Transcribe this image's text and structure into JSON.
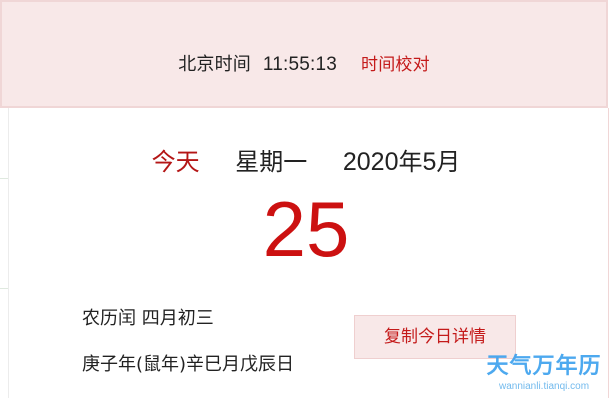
{
  "beijing_time": {
    "label": "北京时间",
    "time": "11:55:13",
    "calibrate_label": "时间校对"
  },
  "date_header": {
    "today_label": "今天",
    "weekday": "星期一",
    "year": "2020",
    "year_unit": "年",
    "month": "5",
    "month_unit": "月"
  },
  "day_number": "25",
  "lunar": {
    "line1": "农历闰 四月初三",
    "line2": "庚子年(鼠年)辛巳月戊辰日"
  },
  "copy_button_label": "复制今日详情",
  "watermark": {
    "title": "天气万年历",
    "url": "wannianli.tianqi.com"
  },
  "colors": {
    "accent_red": "#cc1111",
    "top_bar_bg": "#f8e8e8",
    "watermark_blue": "#3aa0ee"
  }
}
